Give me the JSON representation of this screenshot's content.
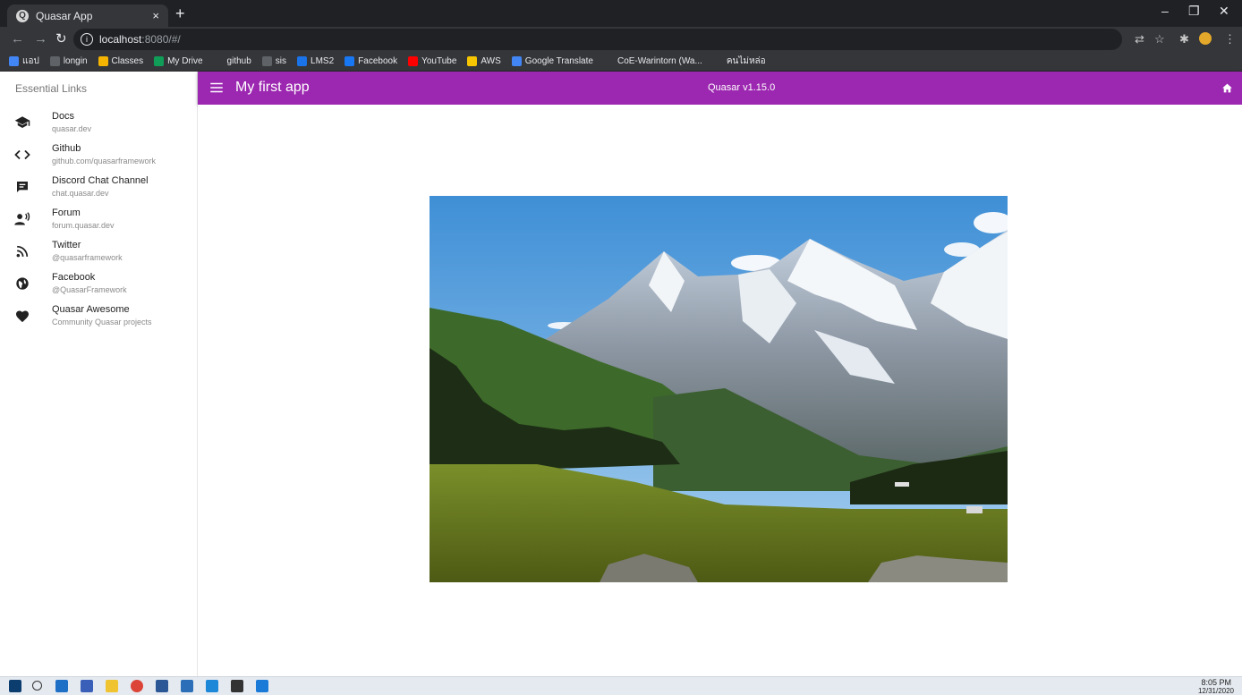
{
  "browser": {
    "tab_title": "Quasar App",
    "tab_close": "×",
    "new_tab": "+",
    "url_host": "localhost",
    "url_rest": ":8080/#/",
    "window": {
      "minimize": "–",
      "restore": "❐",
      "close": "✕"
    },
    "bookmarks": [
      {
        "label": "แอป",
        "color": "#4285f4"
      },
      {
        "label": "longin",
        "color": "#5f6368"
      },
      {
        "label": "Classes",
        "color": "#f4b400"
      },
      {
        "label": "My Drive",
        "color": "#0f9d58"
      },
      {
        "label": "github",
        "color": "#35363a"
      },
      {
        "label": "sis",
        "color": "#5f6368"
      },
      {
        "label": "LMS2",
        "color": "#1a73e8"
      },
      {
        "label": "Facebook",
        "color": "#1877f2"
      },
      {
        "label": "YouTube",
        "color": "#ff0000"
      },
      {
        "label": "AWS",
        "color": "#f7c600"
      },
      {
        "label": "Google Translate",
        "color": "#4285f4"
      },
      {
        "label": "CoE-Warintorn (Wa...",
        "color": "#35363a"
      },
      {
        "label": "คนไม่หล่อ",
        "color": "#35363a"
      }
    ]
  },
  "drawer": {
    "header": "Essential Links",
    "links": [
      {
        "title": "Docs",
        "caption": "quasar.dev",
        "icon": "school-icon"
      },
      {
        "title": "Github",
        "caption": "github.com/quasarframework",
        "icon": "code-icon"
      },
      {
        "title": "Discord Chat Channel",
        "caption": "chat.quasar.dev",
        "icon": "chat-icon"
      },
      {
        "title": "Forum",
        "caption": "forum.quasar.dev",
        "icon": "record-voice-icon"
      },
      {
        "title": "Twitter",
        "caption": "@quasarframework",
        "icon": "rss-feed-icon"
      },
      {
        "title": "Facebook",
        "caption": "@QuasarFramework",
        "icon": "public-icon"
      },
      {
        "title": "Quasar Awesome",
        "caption": "Community Quasar projects",
        "icon": "favorite-icon"
      }
    ]
  },
  "header": {
    "title": "My first app",
    "version": "Quasar v1.15.0",
    "color": "#9c27b0"
  },
  "taskbar": {
    "time": "8:05 PM",
    "date": "12/31/2020"
  }
}
